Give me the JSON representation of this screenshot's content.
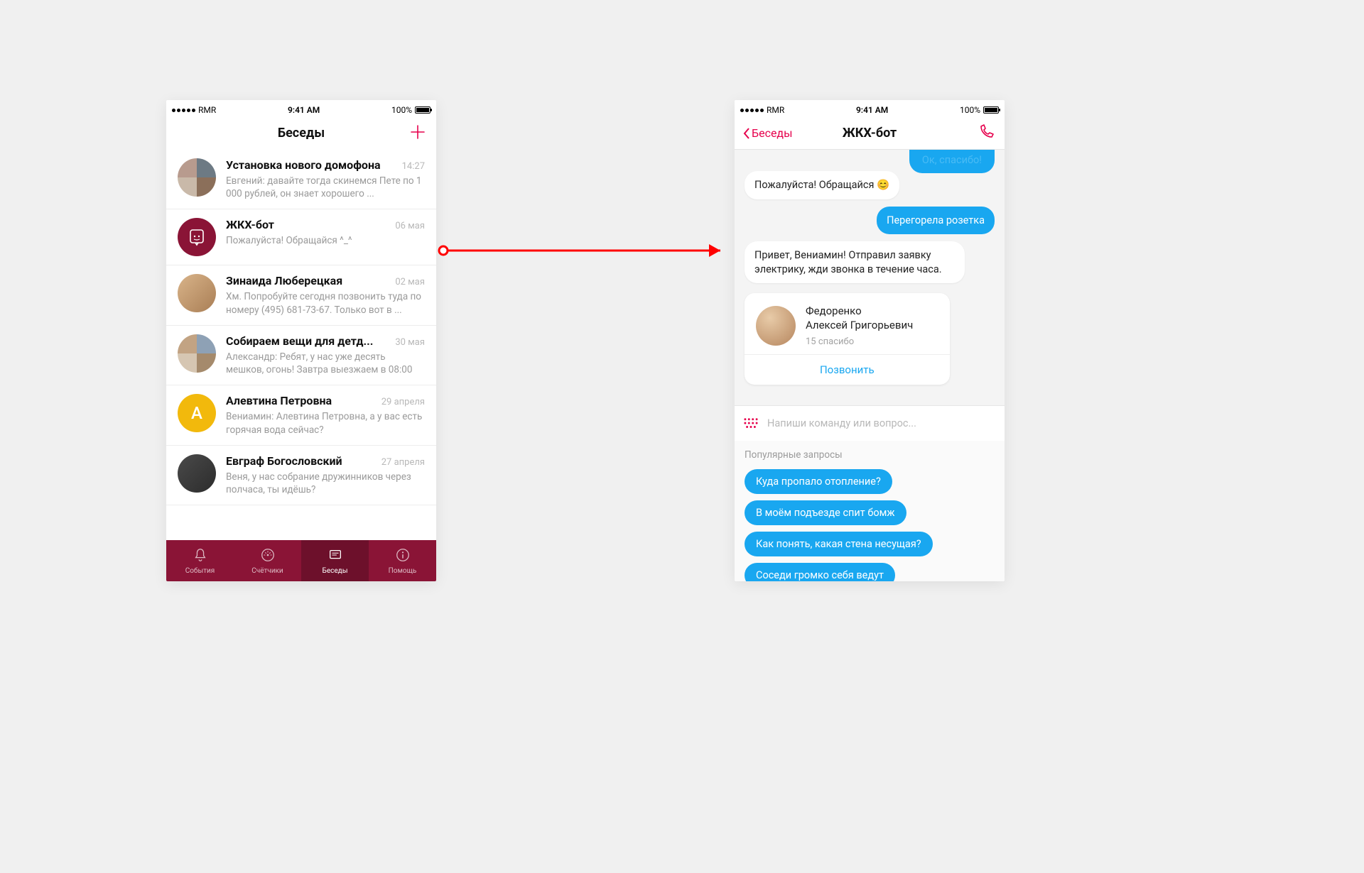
{
  "status_bar": {
    "carrier": "RMR",
    "time": "9:41 AM",
    "battery": "100%"
  },
  "colors": {
    "accent_maroon": "#8a1436",
    "accent_pink": "#e6004c",
    "bubble_blue": "#19a7f0"
  },
  "screen_list": {
    "title": "Беседы",
    "items": [
      {
        "avatar": {
          "type": "group",
          "colors": [
            "#b89b8e",
            "#6d7a84",
            "#c9b9a9",
            "#8b6f5a"
          ]
        },
        "title": "Установка нового домофона",
        "date": "14:27",
        "preview": "Евгений: давайте тогда скинемся Пете по 1 000 рублей, он знает хорошего ..."
      },
      {
        "avatar": {
          "type": "boticon",
          "bg": "#8a1436"
        },
        "title": "ЖКХ-бот",
        "date": "06 мая",
        "preview": "Пожалуйста! Обращайся ^_^"
      },
      {
        "avatar": {
          "type": "photo",
          "bg": "linear-gradient(135deg,#d9b48a,#a97e55)"
        },
        "title": "Зинаида Люберецкая",
        "date": "02 мая",
        "preview": "Хм. Попробуйте сегодня позвонить туда по номеру (495) 681-73-67. Только вот в ..."
      },
      {
        "avatar": {
          "type": "group",
          "colors": [
            "#c2a383",
            "#8ea1b5",
            "#d6c6b2",
            "#a58a6c"
          ]
        },
        "title": "Собираем вещи для детд...",
        "date": "30 мая",
        "preview": "Александр: Ребят, у нас уже десять мешков, огонь! Завтра выезжаем в 08:00"
      },
      {
        "avatar": {
          "type": "letter",
          "letter": "А",
          "bg": "#f2b90c"
        },
        "title": "Алевтина Петровна",
        "date": "29 апреля",
        "preview": "Вениамин: Алевтина Петровна, а у вас есть горячая вода сейчас?"
      },
      {
        "avatar": {
          "type": "photo",
          "bg": "linear-gradient(135deg,#4a4a4a,#2c2c2c)"
        },
        "title": "Евграф Богословский",
        "date": "27 апреля",
        "preview": "Веня, у нас собрание дружинников через полчаса, ты идёшь?"
      }
    ],
    "tabs": [
      {
        "icon": "bell",
        "label": "События"
      },
      {
        "icon": "meter",
        "label": "Счётчики"
      },
      {
        "icon": "chat",
        "label": "Беседы",
        "active": true
      },
      {
        "icon": "info",
        "label": "Помощь"
      }
    ]
  },
  "screen_chat": {
    "back_label": "Беседы",
    "title": "ЖКХ-бот",
    "messages": {
      "partial_out_top": "Ок, спасибо!",
      "m1_in": "Пожалуйста! Обращайся 😊",
      "m2_out": "Перегорела розетка",
      "m3_in": "Привет, Вениамин! Отправил заявку электрику, жди звонка в течение часа."
    },
    "contact_card": {
      "name_line1": "Федоренко",
      "name_line2": "Алексей Григорьевич",
      "sub": "15 спасибо",
      "action": "Позвонить"
    },
    "input_placeholder": "Напиши команду или вопрос...",
    "suggestions_title": "Популярные запросы",
    "suggestions": [
      "Куда пропало отопление?",
      "В моём подъезде спит бомж",
      "Как понять, какая стена несущая?",
      "Соседи громко себя ведут"
    ]
  }
}
